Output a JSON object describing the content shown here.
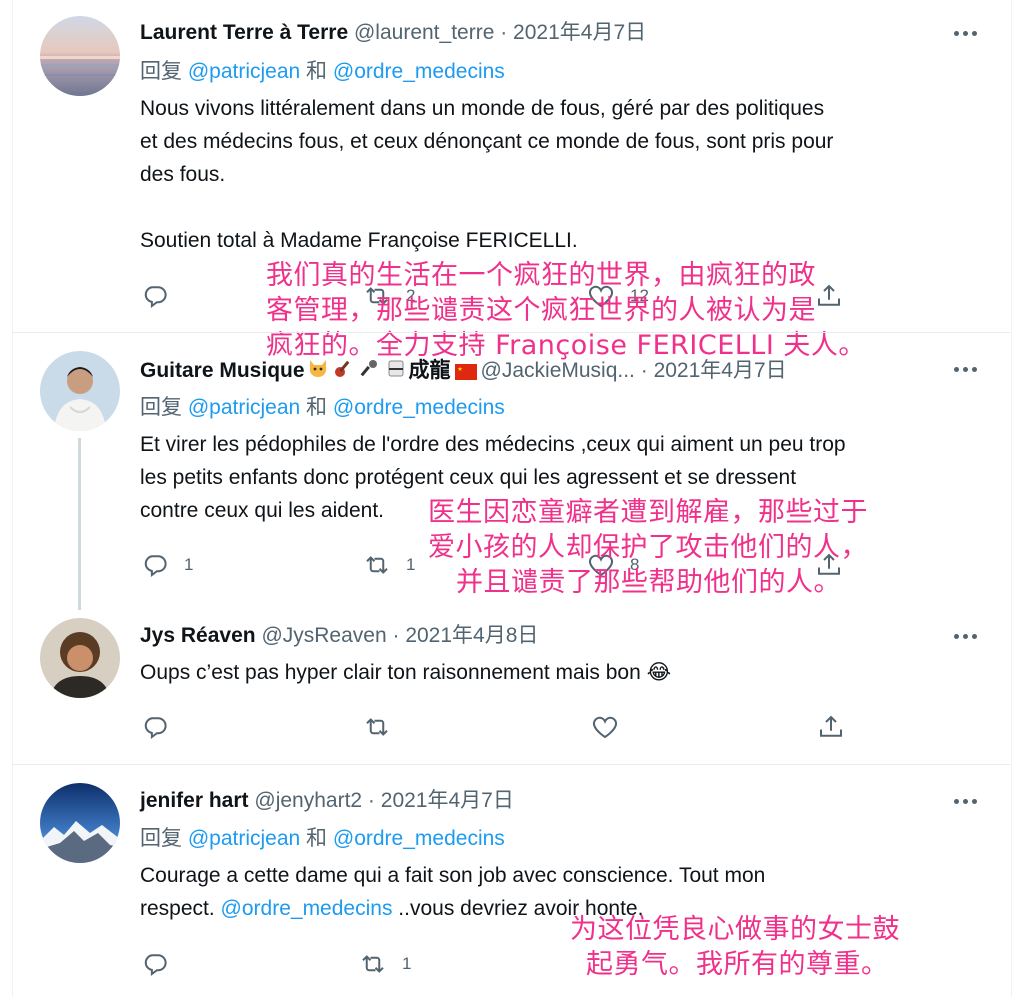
{
  "tweets": [
    {
      "name": "Laurent Terre à Terre",
      "handle": "@laurent_terre",
      "separator": " · ",
      "date": "2021年4月7日",
      "reply_prefix": "回复 ",
      "reply_user1": "@patricjean",
      "reply_and": " 和 ",
      "reply_user2": "@ordre_medecins",
      "text": "Nous vivons littéralement dans un monde de fous, géré par des politiques\net des médecins fous, et ceux dénonçant ce monde de fous, sont pris pour\ndes fous.\n\nSoutien total à Madame Françoise FERICELLI.",
      "reply_count": "",
      "retweet_count": "2",
      "like_count": "12",
      "overlay": [
        "我们真的生活在一个疯狂的世界，由疯狂的政",
        "客管理，那些谴责这个疯狂世界的人被认为是",
        "疯狂的。全力支持 Françoise FERICELLI 夫人。"
      ]
    },
    {
      "name": "Guitare Musique",
      "name_suffix": "成龍",
      "handle": "@JackieMusiq...",
      "separator": " · ",
      "date": "2021年4月7日",
      "reply_prefix": "回复 ",
      "reply_user1": "@patricjean",
      "reply_and": " 和 ",
      "reply_user2": "@ordre_medecins",
      "text": "Et virer les pédophiles de l'ordre des médecins ,ceux qui aiment un peu trop\nles petits enfants donc protégent ceux qui les agressent et se dressent\ncontre ceux  qui  les aident.",
      "reply_count": "1",
      "retweet_count": "1",
      "like_count": "8",
      "overlay": [
        "医生因恋童癖者遭到解雇，那些过于",
        "爱小孩的人却保护了攻击他们的人，",
        "并且谴责了那些帮助他们的人。"
      ]
    },
    {
      "name": "Jys Réaven",
      "handle": "@JysReaven",
      "separator": " · ",
      "date": "2021年4月8日",
      "text": "Oups c’est pas hyper clair ton raisonnement mais bon 😂",
      "reply_count": "",
      "retweet_count": "",
      "like_count": ""
    },
    {
      "name": "jenifer hart",
      "handle": "@jenyhart2",
      "separator": " · ",
      "date": "2021年4月7日",
      "reply_prefix": "回复 ",
      "reply_user1": "@patricjean",
      "reply_and": " 和 ",
      "reply_user2": "@ordre_medecins",
      "text_part1": "Courage a cette dame qui a fait son job avec conscience. Tout mon\nrespect. ",
      "text_mention": "@ordre_medecins",
      "text_part2": " ..vous devriez avoir honte.",
      "reply_count": "",
      "retweet_count": "1",
      "like_count": "",
      "overlay": [
        "为这位凭良心做事的女士鼓",
        "起勇气。我所有的尊重。"
      ]
    }
  ],
  "colors": {
    "link": "#1d9bf0",
    "overlay": "#f0318b",
    "secondary_text": "#536471"
  }
}
